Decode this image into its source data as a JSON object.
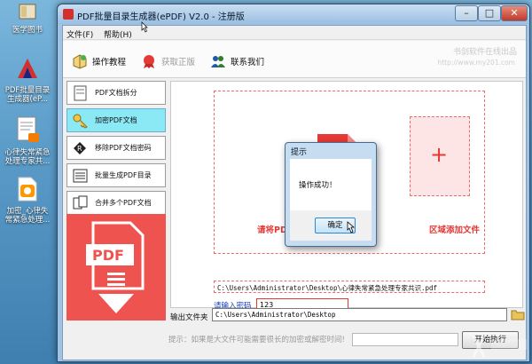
{
  "desktop": {
    "icons": [
      {
        "label_lines": [
          "医学图书"
        ],
        "icon": "book-icon"
      },
      {
        "label_lines": [
          "PDF批量目录",
          "生成器(eP..."
        ],
        "icon": "app-logo-icon"
      },
      {
        "label_lines": [
          "心律失常紧急",
          "处理专家共..."
        ],
        "icon": "document-icon"
      },
      {
        "label_lines": [
          "加密_心律失",
          "常紧急处理..."
        ],
        "icon": "pdf-file-icon"
      }
    ]
  },
  "window": {
    "title": "PDF批量目录生成器(ePDF) V2.0 - 注册版",
    "controls": {
      "minimize": "–",
      "maximize": "□",
      "close": "✕"
    }
  },
  "menubar": {
    "file": "文件(F)",
    "help": "帮助(H)"
  },
  "toolbar": {
    "tutorial": "操作教程",
    "get_register": "获取正版",
    "contact": "联系我们",
    "brand": "书剑软件在线出品",
    "url": "http://www.my201.com"
  },
  "sidebar": {
    "items": [
      {
        "label": "PDF文档拆分",
        "icon": "document-split-icon"
      },
      {
        "label": "加密PDF文档",
        "icon": "key-icon"
      },
      {
        "label": "移除PDF文档密码",
        "icon": "remove-password-icon"
      },
      {
        "label": "批量生成PDF目录",
        "icon": "list-icon"
      },
      {
        "label": "合并多个PDF文档",
        "icon": "merge-icon"
      }
    ],
    "banner_text": "PDF"
  },
  "main": {
    "drop_text_left": "请将PDF",
    "drop_text_right": "区域添加文件",
    "file_path": "C:\\Users\\Administrator\\Desktop\\心律失常紧急处理专家共识.pdf",
    "password_label": "请输入密码",
    "password_value": "123",
    "output_label": "输出文件夹",
    "output_path": "C:\\Users\\Administrator\\Desktop",
    "hint": "提示：如果是大文件可能需要很长的加密或解密时间!",
    "progress": 0,
    "start_label": "开始执行"
  },
  "dialog": {
    "title": "提示",
    "message": "操作成功！",
    "ok": "确定"
  },
  "colors": {
    "accent_red": "#e53935",
    "active_tab": "#8be9f6",
    "desktop_blue": "#5b9cc9"
  }
}
